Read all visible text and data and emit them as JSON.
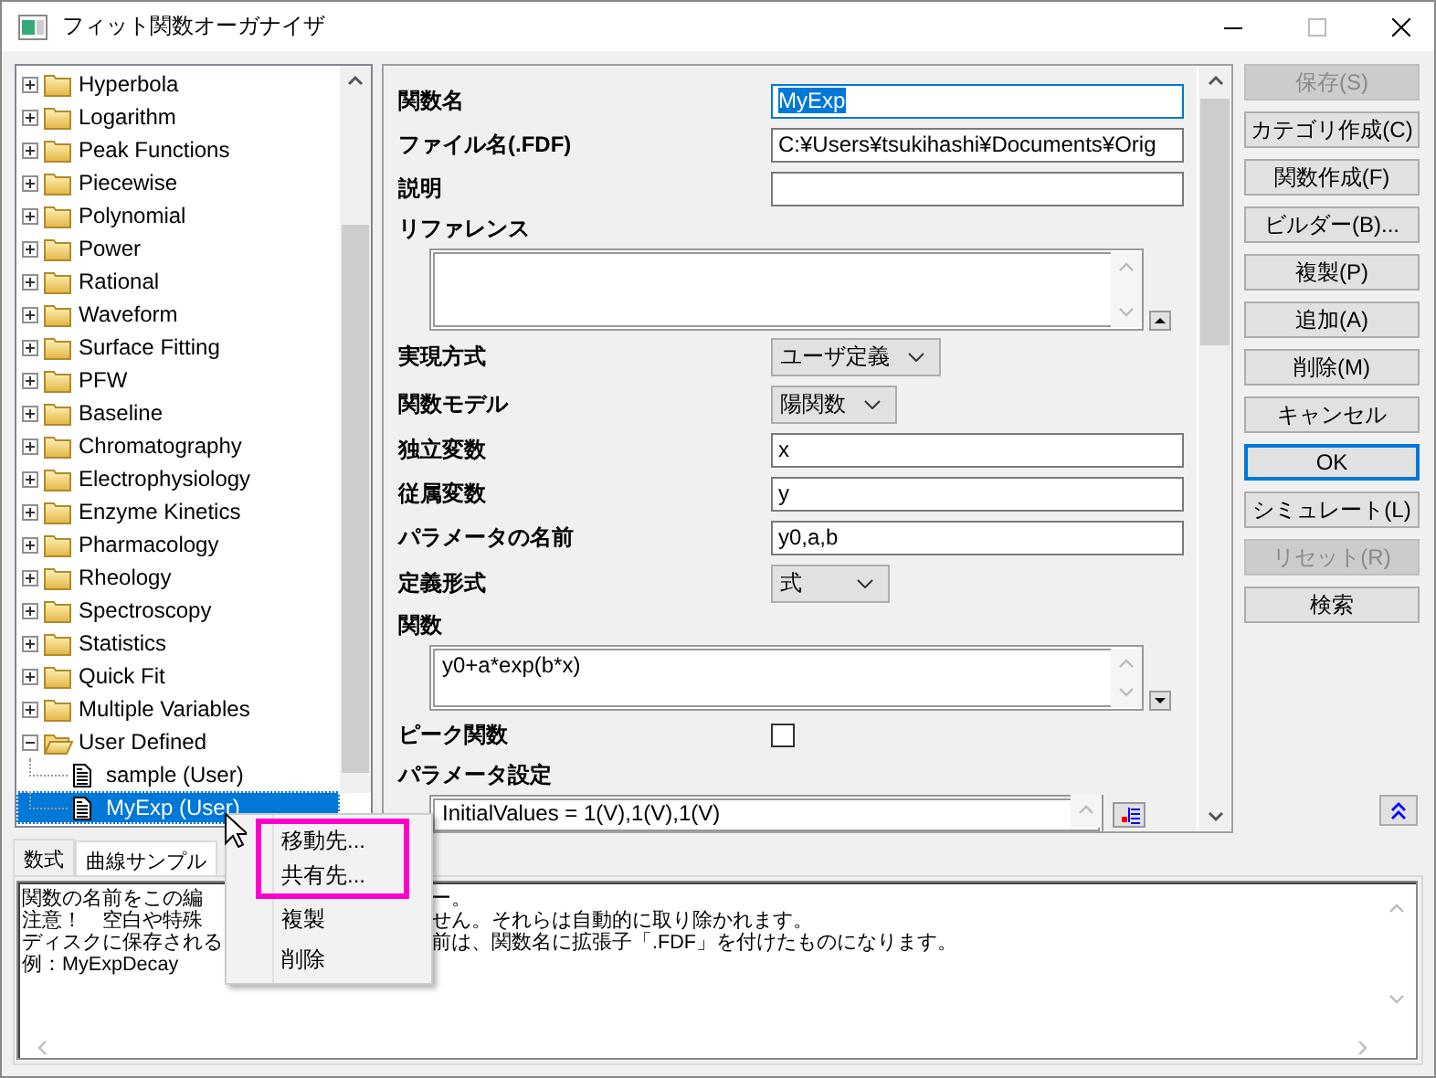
{
  "window": {
    "title": "フィット関数オーガナイザ"
  },
  "tree": {
    "items": [
      {
        "label": "Hyperbola",
        "kind": "folder",
        "expanded": false,
        "selected": false
      },
      {
        "label": "Logarithm",
        "kind": "folder",
        "expanded": false,
        "selected": false
      },
      {
        "label": "Peak Functions",
        "kind": "folder",
        "expanded": false,
        "selected": false
      },
      {
        "label": "Piecewise",
        "kind": "folder",
        "expanded": false,
        "selected": false
      },
      {
        "label": "Polynomial",
        "kind": "folder",
        "expanded": false,
        "selected": false
      },
      {
        "label": "Power",
        "kind": "folder",
        "expanded": false,
        "selected": false
      },
      {
        "label": "Rational",
        "kind": "folder",
        "expanded": false,
        "selected": false
      },
      {
        "label": "Waveform",
        "kind": "folder",
        "expanded": false,
        "selected": false
      },
      {
        "label": "Surface Fitting",
        "kind": "folder",
        "expanded": false,
        "selected": false
      },
      {
        "label": "PFW",
        "kind": "folder",
        "expanded": false,
        "selected": false
      },
      {
        "label": "Baseline",
        "kind": "folder",
        "expanded": false,
        "selected": false
      },
      {
        "label": "Chromatography",
        "kind": "folder",
        "expanded": false,
        "selected": false
      },
      {
        "label": "Electrophysiology",
        "kind": "folder",
        "expanded": false,
        "selected": false
      },
      {
        "label": "Enzyme Kinetics",
        "kind": "folder",
        "expanded": false,
        "selected": false
      },
      {
        "label": "Pharmacology",
        "kind": "folder",
        "expanded": false,
        "selected": false
      },
      {
        "label": "Rheology",
        "kind": "folder",
        "expanded": false,
        "selected": false
      },
      {
        "label": "Spectroscopy",
        "kind": "folder",
        "expanded": false,
        "selected": false
      },
      {
        "label": "Statistics",
        "kind": "folder",
        "expanded": false,
        "selected": false
      },
      {
        "label": "Quick Fit",
        "kind": "folder",
        "expanded": false,
        "selected": false
      },
      {
        "label": "Multiple Variables",
        "kind": "folder",
        "expanded": false,
        "selected": false
      },
      {
        "label": "User Defined",
        "kind": "folder",
        "expanded": true,
        "selected": false,
        "children": [
          {
            "label": "sample (User)",
            "kind": "file",
            "selected": false
          },
          {
            "label": "MyExp (User)",
            "kind": "file",
            "selected": true
          }
        ]
      }
    ]
  },
  "form": {
    "rows": [
      {
        "kind": "text",
        "label": "関数名",
        "value": "MyExp",
        "focused": true
      },
      {
        "kind": "text",
        "label": "ファイル名(.FDF)",
        "value": "C:¥Users¥tsukihashi¥Documents¥Orig",
        "focused": false
      },
      {
        "kind": "text",
        "label": "説明",
        "focused": false
      },
      {
        "kind": "heading",
        "label": "リファレンス"
      },
      {
        "kind": "memo",
        "expanded": true
      },
      {
        "kind": "dropdown",
        "label": "実現方式",
        "value": "ユーザ定義"
      },
      {
        "kind": "dropdown",
        "label": "関数モデル",
        "value": "陽関数"
      },
      {
        "kind": "text",
        "label": "独立変数",
        "value": "x",
        "focused": false
      },
      {
        "kind": "text",
        "label": "従属変数",
        "value": "y",
        "focused": false
      },
      {
        "kind": "text",
        "label": "パラメータの名前",
        "value": "y0,a,b",
        "focused": false
      },
      {
        "kind": "dropdown",
        "label": "定義形式",
        "value": "式"
      },
      {
        "kind": "heading",
        "label": "関数"
      },
      {
        "kind": "memo",
        "value": "y0+a*exp(b*x)",
        "expanded": false
      },
      {
        "kind": "checkbox",
        "label": "ピーク関数",
        "checked": false
      },
      {
        "kind": "heading",
        "label": "パラメータ設定"
      },
      {
        "kind": "table-memo",
        "value": "InitialValues = 1(V),1(V),1(V)"
      }
    ]
  },
  "buttons": [
    {
      "label": "保存(S)",
      "disabled": true,
      "default": false
    },
    {
      "label": "カテゴリ作成(C)",
      "disabled": false,
      "default": false
    },
    {
      "label": "関数作成(F)",
      "disabled": false,
      "default": false
    },
    {
      "label": "ビルダー(B)...",
      "disabled": false,
      "default": false
    },
    {
      "label": "複製(P)",
      "disabled": false,
      "default": false
    },
    {
      "label": "追加(A)",
      "disabled": false,
      "default": false
    },
    {
      "label": "削除(M)",
      "disabled": false,
      "default": false
    },
    {
      "label": "キャンセル",
      "disabled": false,
      "default": false
    },
    {
      "label": "OK",
      "disabled": false,
      "default": true
    },
    {
      "label": "シミュレート(L)",
      "disabled": false,
      "default": false
    },
    {
      "label": "リセット(R)",
      "disabled": true,
      "default": false
    },
    {
      "label": "検索",
      "disabled": false,
      "default": false
    }
  ],
  "tabs": [
    {
      "label": "数式",
      "selected": true
    },
    {
      "label": "曲線サンプル",
      "selected": false
    }
  ],
  "help": {
    "lines": [
      {
        "left": "関数の名前をこの編",
        "right": "ー。"
      },
      {
        "left": "注意！　空白や特殊",
        "right": "せん。それらは自動的に取り除かれます。"
      },
      {
        "left": "ディスクに保存される",
        "right": "前は、関数名に拡張子「.FDF」を付けたものになります。"
      },
      {
        "left": "例：MyExpDecay"
      }
    ]
  },
  "context_menu": {
    "items": [
      {
        "label": "移動先...",
        "highlighted": true
      },
      {
        "label": "共有先...",
        "highlighted": true
      },
      {
        "label": "複製",
        "highlighted": false
      },
      {
        "label": "削除",
        "highlighted": false
      }
    ]
  }
}
